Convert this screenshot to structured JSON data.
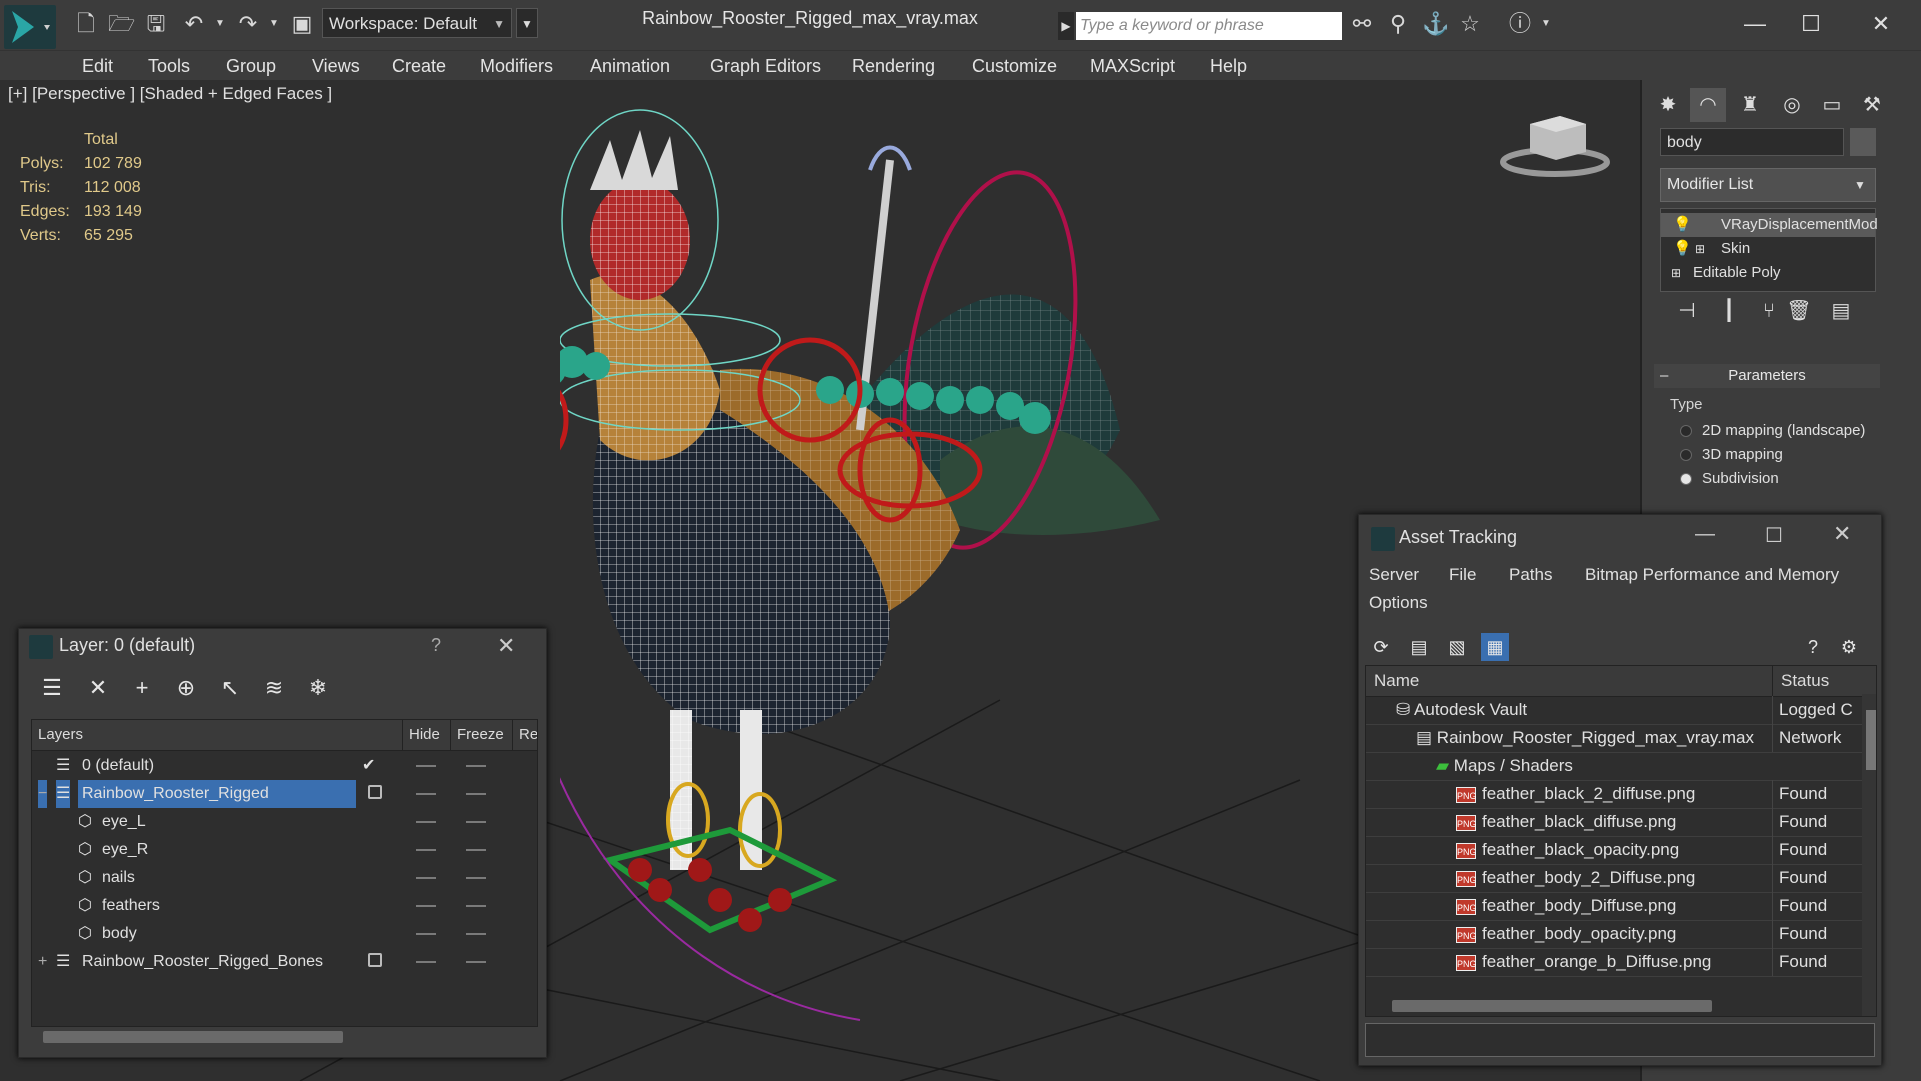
{
  "app": {
    "window_title": "Rainbow_Rooster_Rigged_max_vray.max",
    "workspace": "Workspace: Default",
    "search_placeholder": "Type a keyword or phrase"
  },
  "menu": [
    "Edit",
    "Tools",
    "Group",
    "Views",
    "Create",
    "Modifiers",
    "Animation",
    "Graph Editors",
    "Rendering",
    "Customize",
    "MAXScript",
    "Help"
  ],
  "viewport": {
    "label": "[+] [Perspective ] [Shaded + Edged Faces ]",
    "stats": {
      "header": "Total",
      "rows": [
        {
          "label": "Polys:",
          "value": "102 789"
        },
        {
          "label": "Tris:",
          "value": "112 008"
        },
        {
          "label": "Edges:",
          "value": "193 149"
        },
        {
          "label": "Verts:",
          "value": "65 295"
        }
      ]
    }
  },
  "command_panel": {
    "object_name": "body",
    "modifier_list": "Modifier List",
    "stack": [
      "VRayDisplacementMod",
      "Skin",
      "Editable Poly"
    ],
    "rollout_title": "Parameters",
    "type_label": "Type",
    "type_options": [
      {
        "label": "2D mapping (landscape)",
        "selected": false
      },
      {
        "label": "3D mapping",
        "selected": false
      },
      {
        "label": "Subdivision",
        "selected": true
      }
    ]
  },
  "layer_dialog": {
    "title": "Layer: 0 (default)",
    "help": "?",
    "columns": [
      "Layers",
      "Hide",
      "Freeze",
      "Re"
    ],
    "rows": [
      {
        "name": "0 (default)",
        "level": 0,
        "current": true
      },
      {
        "name": "Rainbow_Rooster_Rigged",
        "level": 0,
        "selected": true,
        "expand": "−"
      },
      {
        "name": "eye_L",
        "level": 1
      },
      {
        "name": "eye_R",
        "level": 1
      },
      {
        "name": "nails",
        "level": 1
      },
      {
        "name": "feathers",
        "level": 1
      },
      {
        "name": "body",
        "level": 1
      },
      {
        "name": "Rainbow_Rooster_Rigged_Bones",
        "level": 0,
        "expand": "+"
      }
    ]
  },
  "asset_dialog": {
    "title": "Asset Tracking",
    "menu": [
      "Server",
      "File",
      "Paths",
      "Bitmap Performance and Memory",
      "Options"
    ],
    "columns": [
      "Name",
      "Status"
    ],
    "rows": [
      {
        "name": "Autodesk Vault",
        "status": "Logged C",
        "level": 0,
        "icon": "vault"
      },
      {
        "name": "Rainbow_Rooster_Rigged_max_vray.max",
        "status": "Network",
        "level": 1,
        "icon": "max"
      },
      {
        "name": "Maps / Shaders",
        "status": "",
        "level": 2,
        "icon": "maps"
      },
      {
        "name": "feather_black_2_diffuse.png",
        "status": "Found",
        "level": 3,
        "icon": "png"
      },
      {
        "name": "feather_black_diffuse.png",
        "status": "Found",
        "level": 3,
        "icon": "png"
      },
      {
        "name": "feather_black_opacity.png",
        "status": "Found",
        "level": 3,
        "icon": "png"
      },
      {
        "name": "feather_body_2_Diffuse.png",
        "status": "Found",
        "level": 3,
        "icon": "png"
      },
      {
        "name": "feather_body_Diffuse.png",
        "status": "Found",
        "level": 3,
        "icon": "png"
      },
      {
        "name": "feather_body_opacity.png",
        "status": "Found",
        "level": 3,
        "icon": "png"
      },
      {
        "name": "feather_orange_b_Diffuse.png",
        "status": "Found",
        "level": 3,
        "icon": "png"
      }
    ],
    "png_tag": "PNG"
  }
}
